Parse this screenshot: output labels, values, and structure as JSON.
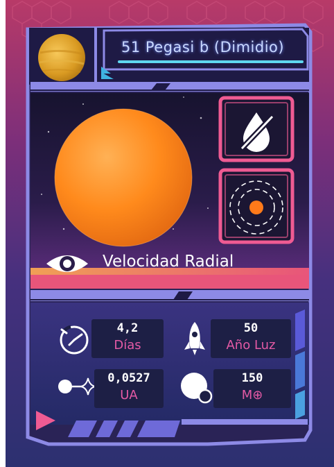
{
  "planet": {
    "name": "51 Pegasi b (Dimidio)",
    "detection_method": "Velocidad Radial"
  },
  "stats": {
    "orbital_period": {
      "value": "4,2",
      "unit": "Días"
    },
    "distance": {
      "value": "50",
      "unit": "Año Luz"
    },
    "semi_major_axis": {
      "value": "0,0527",
      "unit": "UA"
    },
    "mass": {
      "value": "150",
      "unit": "M⊕"
    }
  },
  "icons": {
    "method": "eye-icon",
    "orbital_period": "clock-icon",
    "distance": "rocket-icon",
    "semi_major_axis": "star-distance-icon",
    "mass": "mass-icon",
    "badge_1": "no-water-icon",
    "badge_2": "orbit-icon"
  },
  "colors": {
    "frame": "#8d8ae6",
    "planet_orange": "#ff8a1c",
    "accent_pink": "#e45aa5",
    "badge_border": "#ef5b93"
  }
}
